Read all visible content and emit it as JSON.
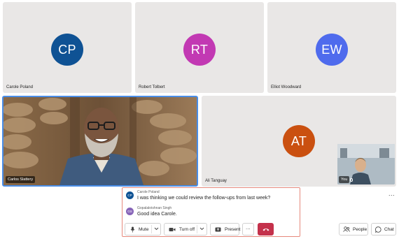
{
  "participants": [
    {
      "initials": "CP",
      "name": "Carole Poland",
      "color": "#0f5294"
    },
    {
      "initials": "RT",
      "name": "Robert Tolbert",
      "color": "#c239b3"
    },
    {
      "initials": "EW",
      "name": "Elliot Woodward",
      "color": "#4f6bed"
    },
    {
      "initials": "AT",
      "name": "Ali Tanguay",
      "color": "#ca5010"
    }
  ],
  "video_tile": {
    "name": "Carlos Slattery"
  },
  "self_view": {
    "label": "You"
  },
  "chat": {
    "messages": [
      {
        "initials": "CP",
        "author": "Carole Poland",
        "text": "I was thinking we could review the follow-ups from last week?",
        "color": "#0f5294"
      },
      {
        "initials": "GS",
        "author": "Gopalakrishnan Singh",
        "text": "Good idea Carole.",
        "color": "#8764b8"
      }
    ]
  },
  "controls": {
    "mute_label": "Mute",
    "camera_label": "Turn off",
    "present_label": "Present",
    "more_label": "...",
    "people_label": "People",
    "chat_label": "Chat",
    "hangup_color": "#c4314b"
  },
  "stage_more_label": "..."
}
